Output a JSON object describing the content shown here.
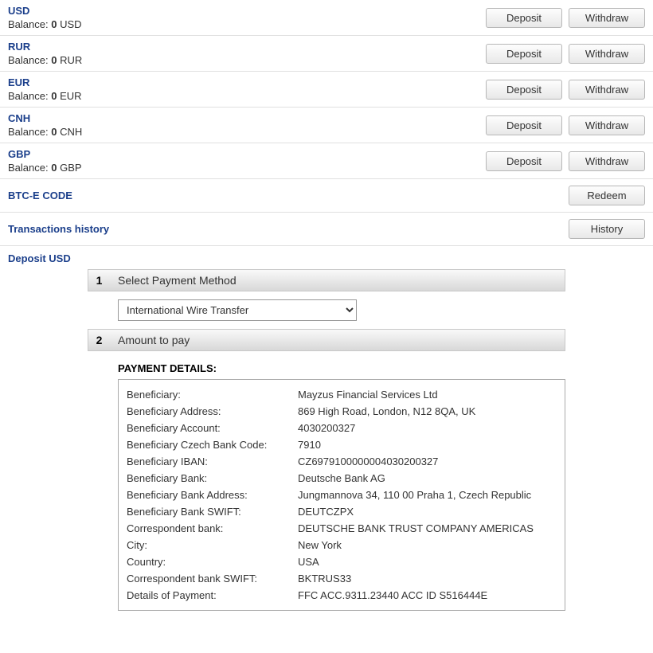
{
  "balanceLabel": "Balance:",
  "depositLabel": "Deposit",
  "withdrawLabel": "Withdraw",
  "currencies": [
    {
      "code": "USD",
      "amount": "0",
      "unit": "USD"
    },
    {
      "code": "RUR",
      "amount": "0",
      "unit": "RUR"
    },
    {
      "code": "EUR",
      "amount": "0",
      "unit": "EUR"
    },
    {
      "code": "CNH",
      "amount": "0",
      "unit": "CNH"
    },
    {
      "code": "GBP",
      "amount": "0",
      "unit": "GBP"
    }
  ],
  "btce": {
    "title": "BTC-E CODE",
    "button": "Redeem"
  },
  "history": {
    "title": "Transactions history",
    "button": "History"
  },
  "depositSection": {
    "title": "Deposit USD",
    "step1": {
      "num": "1",
      "label": "Select Payment Method",
      "selected": "International Wire Transfer"
    },
    "step2": {
      "num": "2",
      "label": "Amount to pay"
    },
    "detailsTitle": "PAYMENT DETAILS:",
    "details": [
      {
        "label": "Beneficiary:",
        "value": "Mayzus Financial Services Ltd"
      },
      {
        "label": "Beneficiary Address:",
        "value": "869 High Road, London, N12 8QA, UK"
      },
      {
        "label": "Beneficiary Account:",
        "value": "4030200327"
      },
      {
        "label": "Beneficiary Czech Bank Code:",
        "value": "7910"
      },
      {
        "label": "Beneficiary IBAN:",
        "value": "CZ6979100000004030200327"
      },
      {
        "label": "Beneficiary Bank:",
        "value": "Deutsche Bank AG"
      },
      {
        "label": "Beneficiary Bank Address:",
        "value": "Jungmannova 34, 110 00 Praha 1, Czech Republic"
      },
      {
        "label": "Beneficiary Bank SWIFT:",
        "value": "DEUTCZPX"
      },
      {
        "label": "Correspondent bank:",
        "value": "DEUTSCHE BANK TRUST COMPANY AMERICAS"
      },
      {
        "label": "City:",
        "value": "New York"
      },
      {
        "label": "Country:",
        "value": "USA"
      },
      {
        "label": "Correspondent bank SWIFT:",
        "value": "BKTRUS33"
      },
      {
        "label": "Details of Payment:",
        "value": "FFC ACC.9311.23440 ACC ID S516444E"
      }
    ]
  }
}
